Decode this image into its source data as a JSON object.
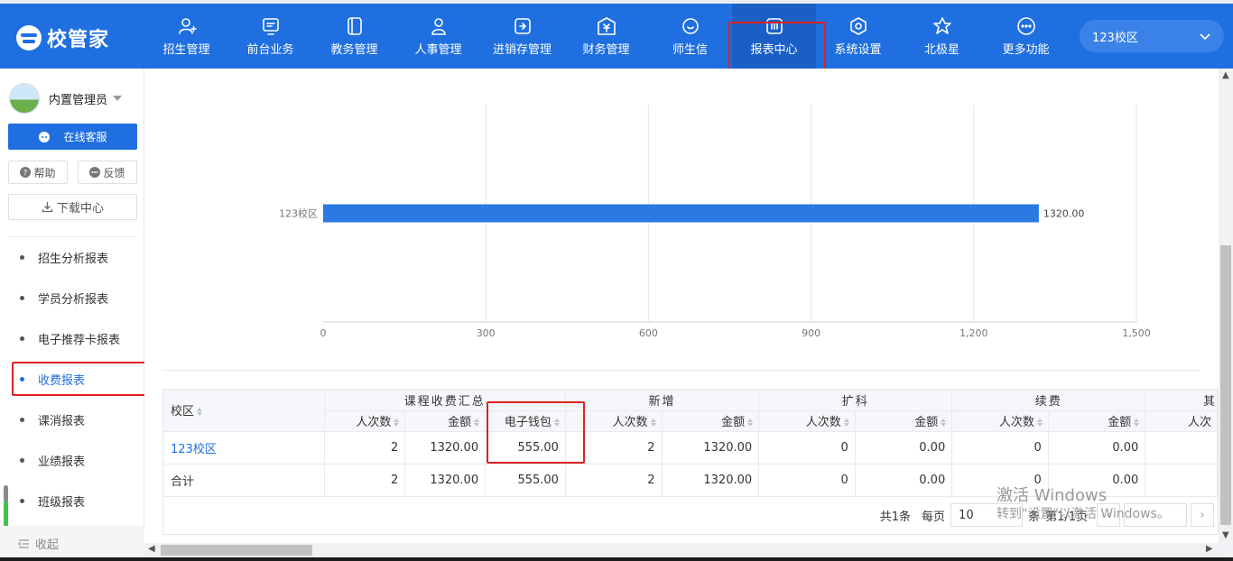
{
  "app": {
    "logo_text": "校管家"
  },
  "nav": [
    {
      "label": "招生管理",
      "icon": "person-add-icon"
    },
    {
      "label": "前台业务",
      "icon": "monitor-icon"
    },
    {
      "label": "教务管理",
      "icon": "book-icon"
    },
    {
      "label": "人事管理",
      "icon": "person-icon"
    },
    {
      "label": "进销存管理",
      "icon": "inventory-icon"
    },
    {
      "label": "财务管理",
      "icon": "yuan-icon"
    },
    {
      "label": "师生信",
      "icon": "chat-icon"
    },
    {
      "label": "报表中心",
      "icon": "report-icon",
      "active": true
    },
    {
      "label": "系统设置",
      "icon": "settings-icon"
    },
    {
      "label": "北极星",
      "icon": "star-icon"
    },
    {
      "label": "更多功能",
      "icon": "more-icon"
    }
  ],
  "campus_select": {
    "value": "123校区"
  },
  "sidebar": {
    "user_name": "内置管理员",
    "service_label": "在线客服",
    "help_label": "帮助",
    "feedback_label": "反馈",
    "download_label": "下载中心",
    "menu": [
      {
        "label": "招生分析报表"
      },
      {
        "label": "学员分析报表"
      },
      {
        "label": "电子推荐卡报表"
      },
      {
        "label": "收费报表",
        "active": true
      },
      {
        "label": "课消报表"
      },
      {
        "label": "业绩报表"
      },
      {
        "label": "班级报表"
      }
    ],
    "collapse_label": "收起"
  },
  "chart_data": {
    "type": "bar",
    "orientation": "horizontal",
    "categories": [
      "123校区"
    ],
    "values": [
      1320.0
    ],
    "value_labels": [
      "1320.00"
    ],
    "xlim": [
      0,
      1500
    ],
    "x_ticks": [
      "0",
      "300",
      "600",
      "900",
      "1,200",
      "1,500"
    ],
    "bar_color": "#2a7ae2",
    "grid": true
  },
  "table": {
    "col_campus": "校区",
    "groups": [
      "课程收费汇总",
      "新增",
      "扩科",
      "续费",
      "其"
    ],
    "sub_headers": [
      "人次数",
      "金额",
      "电子钱包",
      "人次数",
      "金额",
      "人次数",
      "金额",
      "人次数",
      "金额",
      "人次"
    ],
    "rows": [
      {
        "campus": "123校区",
        "cells": [
          "2",
          "1320.00",
          "555.00",
          "2",
          "1320.00",
          "0",
          "0.00",
          "0",
          "0.00",
          ""
        ]
      },
      {
        "campus": "合计",
        "cells": [
          "2",
          "1320.00",
          "555.00",
          "2",
          "1320.00",
          "0",
          "0.00",
          "0",
          "0.00",
          ""
        ]
      }
    ]
  },
  "pager": {
    "total": "共1条",
    "per_page_label": "每页",
    "per_page_value": "10",
    "unit": "条",
    "page_info": "第1/1页"
  },
  "watermark": {
    "line1": "激活 Windows",
    "line2": "转到\"设置\"以激活 Windows。"
  }
}
